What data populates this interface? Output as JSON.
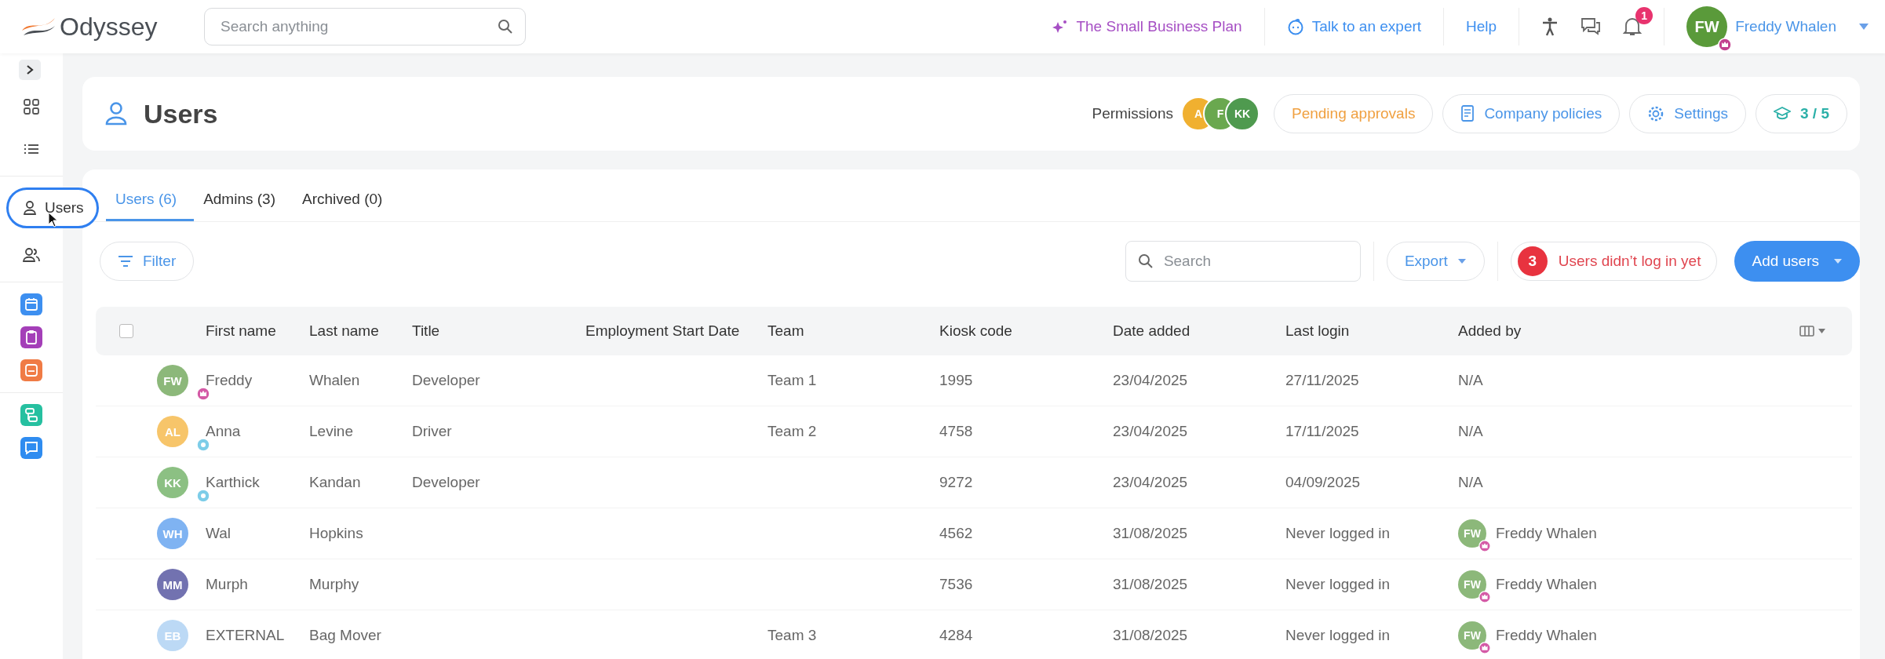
{
  "topbar": {
    "logo": "Odyssey",
    "search": {
      "placeholder": "Search anything"
    },
    "links": [
      {
        "kind": "plan",
        "label": "The Small Business Plan"
      },
      {
        "kind": "expert",
        "label": "Talk to an expert"
      },
      {
        "kind": "help",
        "label": "Help"
      }
    ],
    "notifications": "1",
    "user": {
      "initials": "FW",
      "name": "Freddy Whalen",
      "color": "#5a9a3a"
    }
  },
  "sidebar": {
    "items": [
      {
        "kind": "grid",
        "selected": false
      },
      {
        "kind": "list",
        "selected": false
      },
      {
        "kind": "user",
        "label": "Users",
        "selected": true
      },
      {
        "kind": "team",
        "selected": false
      }
    ],
    "apps": [
      {
        "kind": "calendar",
        "color": "#3d8ff0"
      },
      {
        "kind": "clipboard",
        "color": "#a43fb8"
      },
      {
        "kind": "square",
        "color": "#f07b45"
      },
      {
        "kind": "flow",
        "color": "#26c0a0"
      },
      {
        "kind": "chat",
        "color": "#2f8cf0"
      }
    ]
  },
  "header": {
    "title": "Users",
    "permissions_label": "Permissions",
    "permissions": [
      {
        "initials": "A",
        "color": "#f0b030"
      },
      {
        "initials": "F",
        "color": "#6aa84f"
      },
      {
        "initials": "KK",
        "color": "#4f9a4f"
      }
    ],
    "buttons": [
      {
        "kind": "pending",
        "label": "Pending approvals"
      },
      {
        "kind": "policies",
        "label": "Company policies"
      },
      {
        "kind": "settings",
        "label": "Settings"
      },
      {
        "kind": "progress",
        "label": "3 / 5"
      }
    ]
  },
  "tabs": [
    {
      "label": "Users (6)",
      "selected": true
    },
    {
      "label": "Admins (3)",
      "selected": false
    },
    {
      "label": "Archived (0)",
      "selected": false
    }
  ],
  "toolbar": {
    "filter": "Filter",
    "search": {
      "placeholder": "Search"
    },
    "export": "Export",
    "alert_count": "3",
    "alert": "Users didn’t log in yet",
    "add": "Add users"
  },
  "table": {
    "select_all": {
      "checked": false
    },
    "columns": [
      "First name",
      "Last name",
      "Title",
      "Employment Start Date",
      "Team",
      "Kiosk code",
      "Date added",
      "Last login",
      "Added by"
    ],
    "rows": [
      {
        "initials": "FW",
        "color": "#8cb87a",
        "badge": {
          "kind": "crown"
        },
        "first": "Freddy",
        "last": "Whalen",
        "title": "Developer",
        "team": "Team 1",
        "kiosk": "1995",
        "added": "23/04/2025",
        "login": "27/11/2025",
        "added_by": {
          "kind": "text",
          "text": "N/A"
        }
      },
      {
        "initials": "AL",
        "color": "#f7c56a",
        "badge": {
          "kind": "member"
        },
        "first": "Anna",
        "last": "Levine",
        "title": "Driver",
        "team": "Team 2",
        "kiosk": "4758",
        "added": "23/04/2025",
        "login": "17/11/2025",
        "added_by": {
          "kind": "text",
          "text": "N/A"
        }
      },
      {
        "initials": "KK",
        "color": "#8cc083",
        "badge": {
          "kind": "member"
        },
        "first": "Karthick",
        "last": "Kandan",
        "title": "Developer",
        "team": "",
        "kiosk": "9272",
        "added": "23/04/2025",
        "login": "04/09/2025",
        "added_by": {
          "kind": "text",
          "text": "N/A"
        }
      },
      {
        "initials": "WH",
        "color": "#7fb3f2",
        "first": "Wal",
        "last": "Hopkins",
        "title": "",
        "team": "",
        "kiosk": "4562",
        "added": "31/08/2025",
        "login": "Never logged in",
        "added_by": {
          "kind": "user",
          "initials": "FW",
          "name": "Freddy Whalen"
        }
      },
      {
        "initials": "MM",
        "color": "#7272b0",
        "first": "Murph",
        "last": "Murphy",
        "title": "",
        "team": "",
        "kiosk": "7536",
        "added": "31/08/2025",
        "login": "Never logged in",
        "added_by": {
          "kind": "user",
          "initials": "FW",
          "name": "Freddy Whalen"
        }
      },
      {
        "initials": "EB",
        "color": "#bcd9f5",
        "first": "EXTERNAL",
        "last": "Bag Mover",
        "title": "",
        "team": "Team 3",
        "kiosk": "4284",
        "added": "31/08/2025",
        "login": "Never logged in",
        "added_by": {
          "kind": "user",
          "initials": "FW",
          "name": "Freddy Whalen"
        }
      }
    ]
  }
}
